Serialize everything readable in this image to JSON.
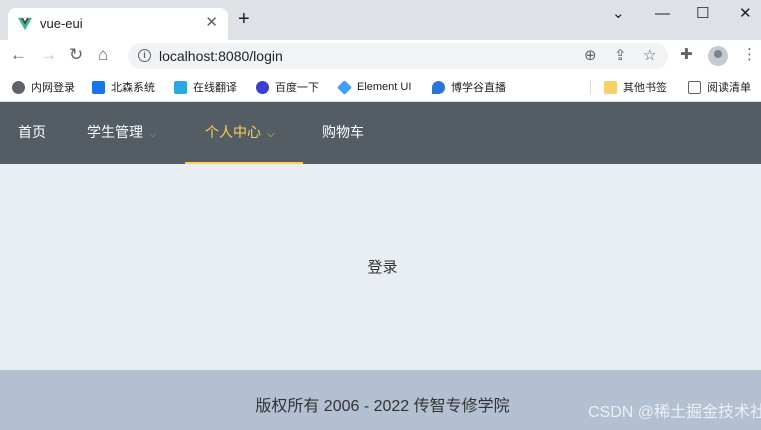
{
  "browser": {
    "tab_title": "vue-eui",
    "new_tab_symbol": "+",
    "close_symbol": "✕",
    "url": "localhost:8080/login",
    "window_controls": [
      "⌄",
      "—",
      "☐",
      "✕"
    ],
    "accent": "#41b883"
  },
  "bookmarks": [
    {
      "label": "内网登录",
      "icon": "globe-icon",
      "color": "#5f6368"
    },
    {
      "label": "北森系统",
      "icon": "info-icon",
      "color": "#1a73e8"
    },
    {
      "label": "在线翻译",
      "icon": "translate-icon",
      "color": "#29a9e0"
    },
    {
      "label": "百度一下",
      "icon": "baidu-icon",
      "color": "#3b3fd1"
    },
    {
      "label": "Element UI",
      "icon": "element-icon",
      "color": "#409eff"
    },
    {
      "label": "博学谷直播",
      "icon": "bing-icon",
      "color": "#2a74d8"
    },
    {
      "label": "其他书签",
      "icon": "folder-icon",
      "color": "#f6d16a"
    },
    {
      "label": "阅读清单",
      "icon": "reading-list-icon",
      "color": "#5f6368"
    }
  ],
  "menu": {
    "items": [
      {
        "label": "首页",
        "has_arrow": false,
        "active": false
      },
      {
        "label": "学生管理",
        "has_arrow": true,
        "active": false
      },
      {
        "label": "个人中心",
        "has_arrow": true,
        "active": true
      },
      {
        "label": "购物车",
        "has_arrow": false,
        "active": false
      }
    ],
    "arrow": "⌵",
    "background": "#545c64",
    "active_color": "#ffd04b"
  },
  "main": {
    "text": "登录",
    "background": "#e9eef3"
  },
  "footer": {
    "text": "版权所有 2006 - 2022 传智专修学院",
    "background": "#b3c0d1"
  },
  "watermark": "CSDN @稀土掘金技术社区"
}
